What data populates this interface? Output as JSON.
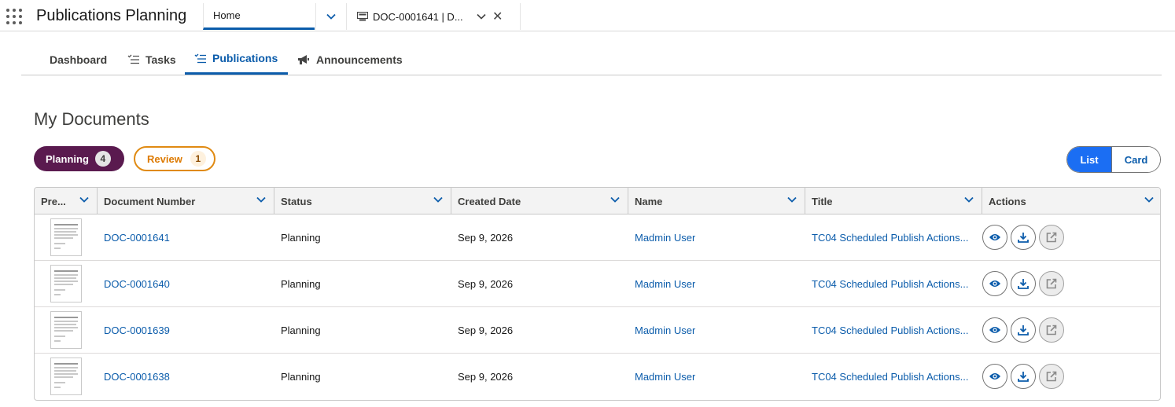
{
  "app": {
    "title": "Publications Planning",
    "home_tab": "Home",
    "doc_tab": "DOC-0001641 | D..."
  },
  "subtabs": [
    {
      "label": "Dashboard",
      "icon": "none"
    },
    {
      "label": "Tasks",
      "icon": "checklist-icon"
    },
    {
      "label": "Publications",
      "icon": "checklist-icon",
      "active": true
    },
    {
      "label": "Announcements",
      "icon": "megaphone-icon"
    }
  ],
  "page": {
    "title": "My Documents"
  },
  "filters": {
    "planning": {
      "label": "Planning",
      "count": "4",
      "active": true
    },
    "review": {
      "label": "Review",
      "count": "1"
    }
  },
  "view_toggle": {
    "list": "List",
    "card": "Card",
    "selected": "List"
  },
  "table": {
    "columns": [
      "Pre...",
      "Document Number",
      "Status",
      "Created Date",
      "Name",
      "Title",
      "Actions"
    ],
    "rows": [
      {
        "doc": "DOC-0001641",
        "status": "Planning",
        "date": "Sep 9, 2026",
        "name": "Madmin User",
        "title": "TC04 Scheduled Publish Actions..."
      },
      {
        "doc": "DOC-0001640",
        "status": "Planning",
        "date": "Sep 9, 2026",
        "name": "Madmin User",
        "title": "TC04 Scheduled Publish Actions..."
      },
      {
        "doc": "DOC-0001639",
        "status": "Planning",
        "date": "Sep 9, 2026",
        "name": "Madmin User",
        "title": "TC04 Scheduled Publish Actions..."
      },
      {
        "doc": "DOC-0001638",
        "status": "Planning",
        "date": "Sep 9, 2026",
        "name": "Madmin User",
        "title": "TC04 Scheduled Publish Actions..."
      }
    ],
    "row_actions": [
      "preview-icon",
      "download-icon",
      "open-external-icon"
    ]
  },
  "colors": {
    "accent": "#0b5cab",
    "toggle_active": "#1b6ef3",
    "planning_pill": "#5a1a4f",
    "review_pill": "#dd7a01"
  }
}
